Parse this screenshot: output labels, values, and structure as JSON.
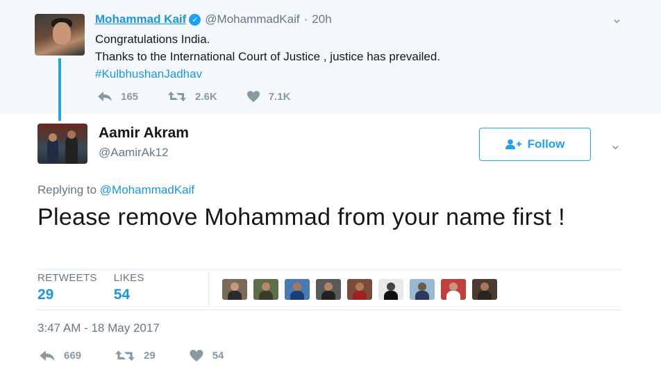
{
  "parent_tweet": {
    "author_name": "Mohammad Kaif",
    "author_handle": "@MohammadKaif",
    "separator": "·",
    "time": "20h",
    "text_line1": "Congratulations India.",
    "text_line2": "Thanks to the International Court of Justice , justice has prevailed.",
    "hashtag": "#KulbhushanJadhav",
    "replies": "165",
    "retweets": "2.6K",
    "likes": "7.1K"
  },
  "main_tweet": {
    "author_name": "Aamir Akram",
    "author_handle": "@AamirAk12",
    "follow_label": "Follow",
    "replying_prefix": "Replying to",
    "replying_to": "@MohammadKaif",
    "text": "Please remove Mohammad from your name first !",
    "retweets_label": "RETWEETS",
    "retweets_count": "29",
    "likes_label": "LIKES",
    "likes_count": "54",
    "timestamp": "3:47 AM - 18 May 2017",
    "action_replies": "669",
    "action_retweets": "29",
    "action_likes": "54"
  },
  "liker_avatars": [
    {
      "bg": "#7a6a5a",
      "head": "#c49a7a",
      "body": "#2b2b2b"
    },
    {
      "bg": "#5f6e4a",
      "head": "#b88a6a",
      "body": "#3c3c2c"
    },
    {
      "bg": "#4a78b0",
      "head": "#a8785c",
      "body": "#1d3d78"
    },
    {
      "bg": "#5a5a5a",
      "head": "#b38566",
      "body": "#222222"
    },
    {
      "bg": "#7a4a3a",
      "head": "#b07a5a",
      "body": "#a02020"
    },
    {
      "bg": "#e8e8e8",
      "head": "#444444",
      "body": "#111111"
    },
    {
      "bg": "#9ab8d0",
      "head": "#6a5a4a",
      "body": "#2a3a5a"
    },
    {
      "bg": "#c04040",
      "head": "#c9967a",
      "body": "#ffffff"
    },
    {
      "bg": "#4a3a30",
      "head": "#a8785c",
      "body": "#2a2420"
    }
  ],
  "colors": {
    "accent": "#1da1f2",
    "link": "#1b95e0",
    "muted": "#657786",
    "thread_line": "#29a3d9",
    "parent_bg": "#f5f8fa"
  }
}
